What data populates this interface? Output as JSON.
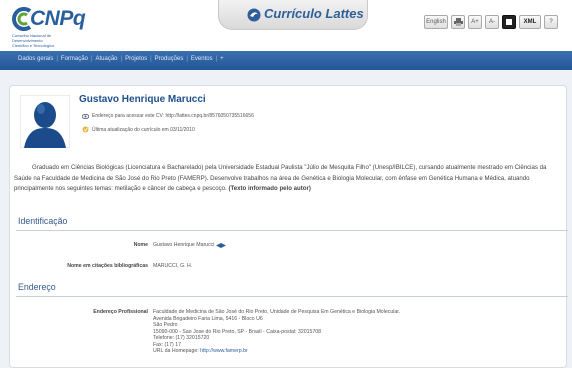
{
  "header": {
    "logo_text": "CNPq",
    "logo_subtitle_line1": "Conselho Nacional de Desenvolvimento",
    "logo_subtitle_line2": "Científico e Tecnológico",
    "site_title": "Currículo Lattes",
    "language_button": "English",
    "xml_button": "XML",
    "help_button": "?",
    "font_small_button": "A+",
    "font_large_button": "A-"
  },
  "nav": {
    "items": [
      "Dados gerais",
      "Formação",
      "Atuação",
      "Projetos",
      "Produções",
      "Eventos",
      "+"
    ]
  },
  "profile": {
    "name": "Gustavo Henrique Marucci",
    "cv_address": "Endereço para acessar este CV: http://lattes.cnpq.br/8576050735516656",
    "last_update": "Última atualização do currículo em 03/11/2010"
  },
  "summary": {
    "text": "Graduado em Ciências Biológicas (Licenciatura e Bacharelado) pela Universidade Estadual Paulista \"Júlio de Mesquita Filho\" (Unesp/IBILCE), cursando atualmente mestrado em Ciências da Saúde na Faculdade de Medicina de São José do Rio Preto (FAMERP). Desenvolve trabalhos na área de Genética e Biologia Molecular, com ênfase em Genética Humana e Médica, atuando principalmente nos seguintes temas: metilação e câncer de cabeça e pescoço.",
    "source_note": "(Texto informado pelo autor)"
  },
  "identificacao": {
    "title": "Identificação",
    "name_label": "Nome",
    "name_value": "Gustavo Henrique Marucci",
    "citation_label": "Nome em citações bibliográficas",
    "citation_value": "MARUCCI, G. H."
  },
  "endereco": {
    "title": "Endereço",
    "label": "Endereço Profissional",
    "lines": [
      "Faculdade de Medicina de São José do Rio Preto, Unidade de Pesquisa Em Genética e Biologia Molecular.",
      "Avenida Brigadeiro Faria Lima, 5416 - Bloco U6",
      "São Pedro",
      "15090-000 - Sao Jose do Rio Preto, SP - Brasil - Caixa-postal: 32015708",
      "Telefone: (17) 32015720",
      "Fax: (17) 17"
    ],
    "url_prefix": "URL da Homepage:",
    "url": "http://www.famerp.br"
  }
}
